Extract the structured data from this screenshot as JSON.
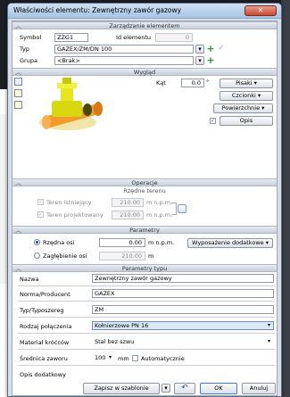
{
  "window": {
    "title": "Właściwości elementu: Zewnętrzny zawór gazowy",
    "close": "✕"
  },
  "sections": {
    "zarzadzanie": "Zarządzanie elementem",
    "wyglad": "Wygląd",
    "operacje": "Operacje",
    "rzedne": "Rzędne terenu",
    "parametry": "Parametry",
    "parametry_typu": "Parametry typu"
  },
  "element": {
    "symbol_label": "Symbol",
    "symbol_value": "ZZG1",
    "id_label": "Id elementu",
    "id_value": "0",
    "typ_label": "Typ",
    "typ_value": "GAZEX/ZM/DN 100",
    "grupa_label": "Grupa",
    "grupa_value": "<Brak>"
  },
  "wyglad": {
    "kat_label": "Kąt",
    "kat_value": "0.0",
    "kat_unit": "°",
    "pisaki": "Pisaki",
    "czcionki": "Czcionki",
    "powierzchnie": "Powierzchnie",
    "opis": "Opis",
    "opis_checked": "✓"
  },
  "rzedne": {
    "teren_istniejacy_label": "Teren istniejący",
    "teren_istniejacy_value": "210.00",
    "teren_istniejacy_unit": "m n.p.m.",
    "teren_projektowany_label": "Teren projektowany",
    "teren_projektowany_value": "210.00",
    "teren_projektowany_unit": "m n.p.m."
  },
  "parametry": {
    "rzedna_osi_label": "Rzędna osi",
    "rzedna_osi_value": "0.00",
    "rzedna_osi_unit": "m n.p.m.",
    "zaglebienie_label": "Zagłębienie osi",
    "zaglebienie_value": "210.00",
    "zaglebienie_unit": "m",
    "wyposazenie": "Wyposażenie dodatkowe"
  },
  "typu": {
    "nazwa_label": "Nazwa",
    "nazwa_value": "Zewnętrzny zawór gazowy",
    "norma_label": "Norma/Producent",
    "norma_value": "GAZEX",
    "typ_label": "Typ/Typoszereg",
    "typ_value": "ZM",
    "rodzaj_label": "Rodzaj połączenia",
    "rodzaj_value": "Kołnierzowe PN 16",
    "material_label": "Materiał króćców",
    "material_value": "Stal bez szwu",
    "srednica_label": "Średnica zaworu",
    "srednica_value": "100",
    "srednica_unit": "mm",
    "automatycznie": "Automatycznie",
    "opis_label": "Opis dodatkowy",
    "opis_value": ""
  },
  "buttons": {
    "zapisz": "Zapisz w szablonie",
    "ok": "OK",
    "anuluj": "Anuluj",
    "undo": "↶"
  },
  "icons": {
    "dropdown": "▾",
    "chevron_up": "︿",
    "plus": "+",
    "check": "✓"
  }
}
